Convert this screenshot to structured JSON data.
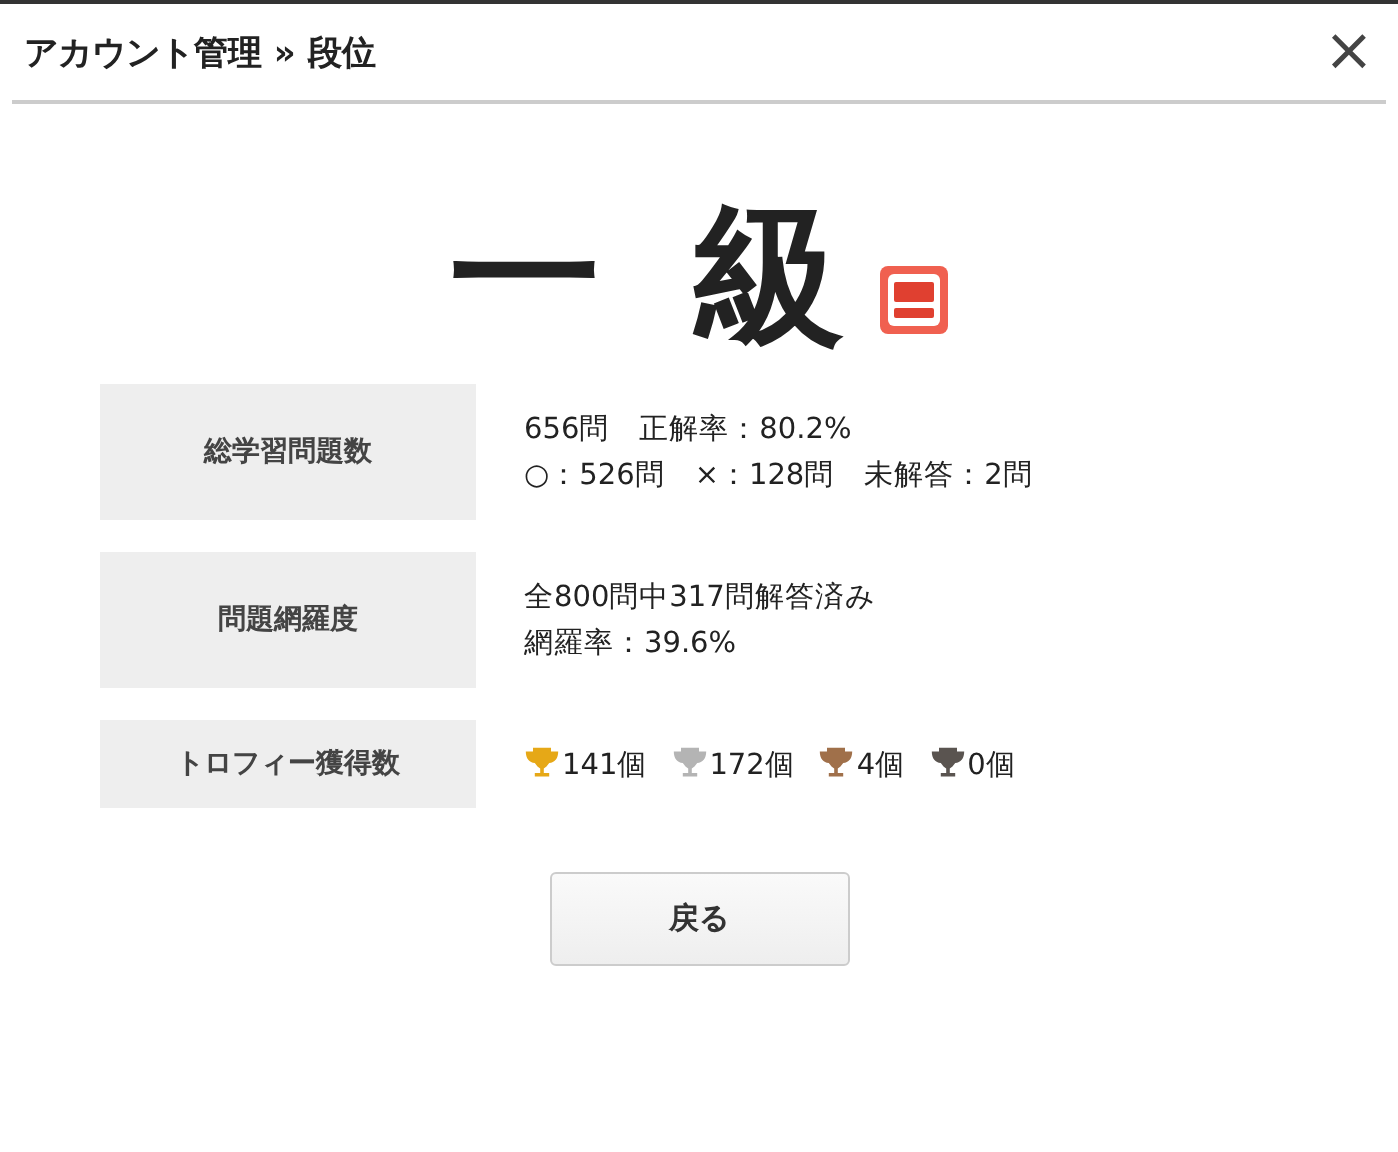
{
  "window": {
    "title": "アカウント管理 » 段位",
    "close": "×"
  },
  "rank": "一 級",
  "rows": [
    {
      "label": "総学習問題数",
      "lines": [
        "656問　正解率：80.2%",
        "○：526問　×：128問　未解答：2問"
      ]
    },
    {
      "label": "問題網羅度",
      "lines": [
        "全800問中317問解答済み",
        "網羅率：39.6%"
      ]
    },
    {
      "label": "トロフィー獲得数",
      "trophies": [
        {
          "count": "141個",
          "color": "#e6a817"
        },
        {
          "count": "172個",
          "color": "#b4b4b4"
        },
        {
          "count": "4個",
          "color": "#a0704a"
        },
        {
          "count": "0個",
          "color": "#5a5450"
        }
      ]
    }
  ],
  "button": "戻る"
}
